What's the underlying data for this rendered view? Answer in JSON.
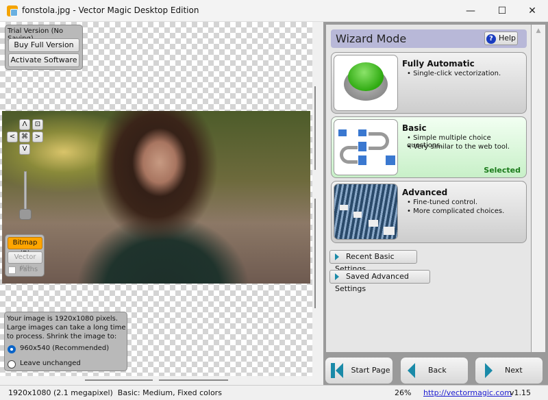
{
  "window": {
    "title": "fonstola.jpg - Vector Magic Desktop Edition",
    "minimize": "—",
    "maximize": "☐",
    "close": "✕"
  },
  "trial": {
    "label": "Trial Version (No Saving)",
    "buy": "Buy Full Version",
    "activate": "Activate Software"
  },
  "nav": {
    "up": "Λ",
    "down": "V",
    "left": "<",
    "right": ">",
    "center": "⌘",
    "fit": "⊡"
  },
  "view": {
    "bitmap": "Bitmap (B)",
    "vector": "Vector (V)",
    "paths": "Paths",
    "paths_checked": false,
    "active": "bitmap",
    "accent": "#ffa500"
  },
  "shrink": {
    "message": "Your image is 1920x1080 pixels. Large images can take a long time to process. Shrink the image to:",
    "options": [
      {
        "label": "960x540 (Recommended)",
        "selected": true
      },
      {
        "label": "Leave unchanged",
        "selected": false
      }
    ]
  },
  "wizard": {
    "title": "Wizard Mode",
    "help": "Help",
    "modes": [
      {
        "title": "Fully Automatic",
        "bullets": [
          "Single-click vectorization."
        ],
        "selected": false
      },
      {
        "title": "Basic",
        "bullets": [
          "Simple multiple choice questions.",
          "Very similar to the web tool."
        ],
        "selected": true,
        "selected_label": "Selected"
      },
      {
        "title": "Advanced",
        "bullets": [
          "Fine-tuned control.",
          "More complicated choices."
        ],
        "selected": false
      }
    ],
    "recent": "Recent Basic Settings",
    "saved": "Saved Advanced Settings"
  },
  "footer": {
    "start": "Start Page",
    "back": "Back",
    "next": "Next"
  },
  "status": {
    "info": "1920x1080 (2.1 megapixel)  Basic: Medium, Fixed colors",
    "zoom": "26%",
    "link": "http://vectormagic.com",
    "version": "v1.15"
  }
}
